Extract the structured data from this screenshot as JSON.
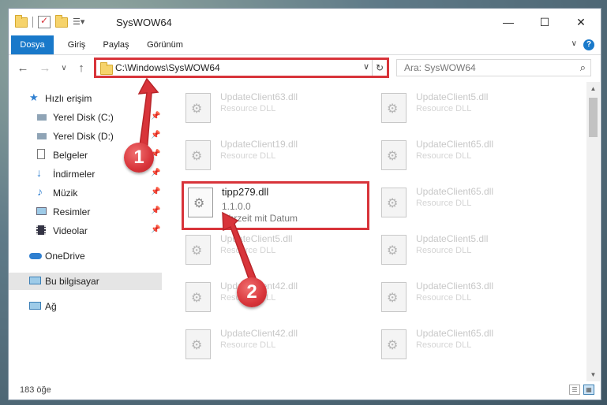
{
  "window": {
    "title": "SysWOW64",
    "controls": {
      "minimize": "—",
      "maximize": "☐",
      "close": "✕"
    }
  },
  "ribbon": {
    "tabs": [
      "Dosya",
      "Giriş",
      "Paylaş",
      "Görünüm"
    ],
    "help": "?"
  },
  "address": {
    "path": "C:\\Windows\\SysWOW64",
    "search_placeholder": "Ara: SysWOW64"
  },
  "nav": {
    "items": [
      {
        "label": "Hızlı erişim",
        "icon": "star-icon",
        "pinned": false
      },
      {
        "label": "Yerel Disk (C:)",
        "icon": "drive-icon",
        "pinned": true
      },
      {
        "label": "Yerel Disk (D:)",
        "icon": "drive-icon",
        "pinned": true
      },
      {
        "label": "Belgeler",
        "icon": "document-icon",
        "pinned": true
      },
      {
        "label": "İndirmeler",
        "icon": "download-icon",
        "pinned": true
      },
      {
        "label": "Müzik",
        "icon": "music-icon",
        "pinned": true
      },
      {
        "label": "Resimler",
        "icon": "picture-icon",
        "pinned": true
      },
      {
        "label": "Videolar",
        "icon": "video-icon",
        "pinned": true
      },
      {
        "label": "OneDrive",
        "icon": "cloud-icon",
        "pinned": false
      },
      {
        "label": "Bu bilgisayar",
        "icon": "computer-icon",
        "pinned": false
      },
      {
        "label": "Ağ",
        "icon": "network-icon",
        "pinned": false
      }
    ]
  },
  "files": [
    {
      "name": "UpdateClient63.dll",
      "desc": "Resource DLL"
    },
    {
      "name": "UpdateClient5.dll",
      "desc": "Resource DLL"
    },
    {
      "name": "UpdateClient19.dll",
      "desc": "Resource DLL"
    },
    {
      "name": "UpdateClient65.dll",
      "desc": "Resource DLL"
    },
    {
      "name": "tipp279.dll",
      "desc": "1.1.0.0",
      "desc2": "Uhrzeit mit Datum"
    },
    {
      "name": "UpdateClient65.dll",
      "desc": "Resource DLL"
    },
    {
      "name": "UpdateClient5.dll",
      "desc": "Resource DLL"
    },
    {
      "name": "UpdateClient5.dll",
      "desc": "Resource DLL"
    },
    {
      "name": "UpdateClient42.dll",
      "desc": "Resource DLL"
    },
    {
      "name": "UpdateClient63.dll",
      "desc": "Resource DLL"
    },
    {
      "name": "UpdateClient42.dll",
      "desc": "Resource DLL"
    },
    {
      "name": "UpdateClient65.dll",
      "desc": "Resource DLL"
    }
  ],
  "status": {
    "count": "183 öğe"
  },
  "annotations": {
    "step1": "1",
    "step2": "2"
  },
  "colors": {
    "highlight": "#d8343a",
    "accent": "#1979ca"
  }
}
